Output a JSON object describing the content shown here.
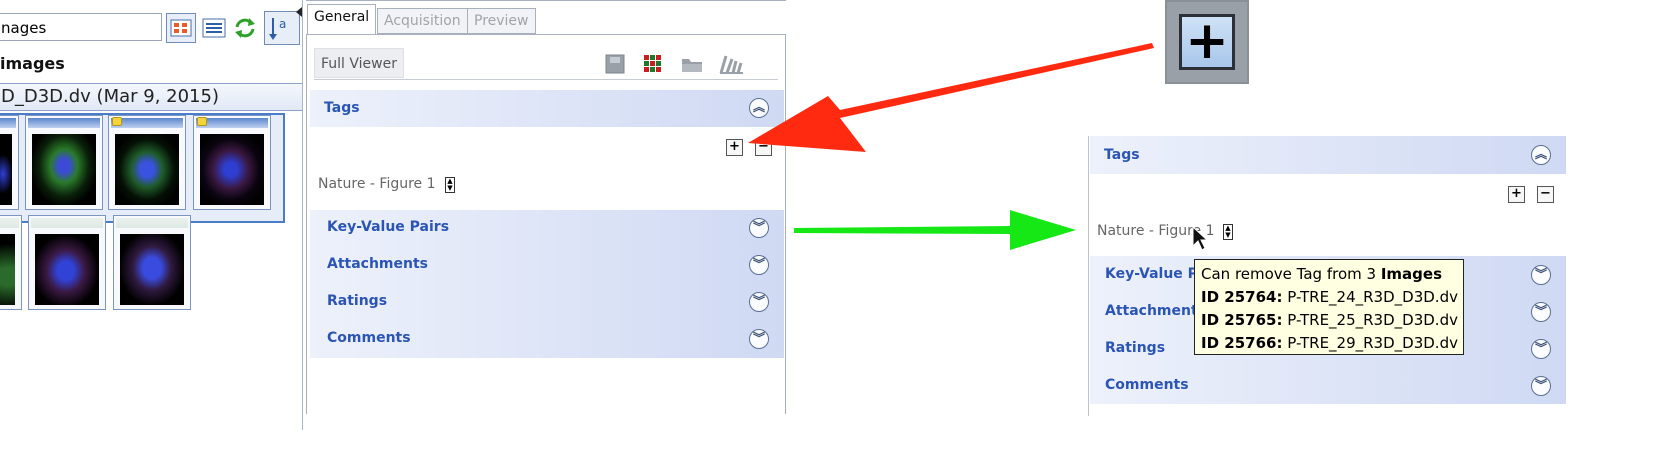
{
  "left_pane": {
    "search_value": "nages",
    "group_title": "images",
    "dataset_title": "D_D3D.dv (Mar 9, 2015)"
  },
  "center": {
    "tabs": [
      "General",
      "Acquisition",
      "Preview"
    ],
    "viewer_button": "Full Viewer",
    "sections": [
      "Tags",
      "Key-Value Pairs",
      "Attachments",
      "Ratings",
      "Comments"
    ],
    "tag_label": "Nature - Figure 1"
  },
  "right": {
    "sections": [
      "Tags",
      "Key-Value Pairs",
      "Attachments",
      "Ratings",
      "Comments"
    ],
    "tag_label": "Nature - Figure 1",
    "key_value_partial": "Key-Value P",
    "attachments_partial": "Attachments",
    "tooltip": {
      "title_prefix": "Can remove Tag from 3",
      "title_bold": "Images",
      "rows": [
        {
          "id": "ID 25764:",
          "name": "P-TRE_24_R3D_D3D.dv"
        },
        {
          "id": "ID 25765:",
          "name": "P-TRE_25_R3D_D3D.dv"
        },
        {
          "id": "ID 25766:",
          "name": "P-TRE_29_R3D_D3D.dv"
        }
      ]
    }
  },
  "colors": {
    "section_text": "#2b55b5",
    "red_arrow": "#ff2a10",
    "green_arrow": "#15e815",
    "tooltip_bg": "#ffffe1"
  },
  "icons": [
    "thumbnail-view-icon",
    "list-view-icon",
    "refresh-icon",
    "sort-icon",
    "save-icon",
    "color-channels-icon",
    "folder-icon",
    "chart-icon",
    "add-icon",
    "remove-icon",
    "chevron-icon",
    "spinner-icon",
    "mouse-cursor-icon"
  ]
}
